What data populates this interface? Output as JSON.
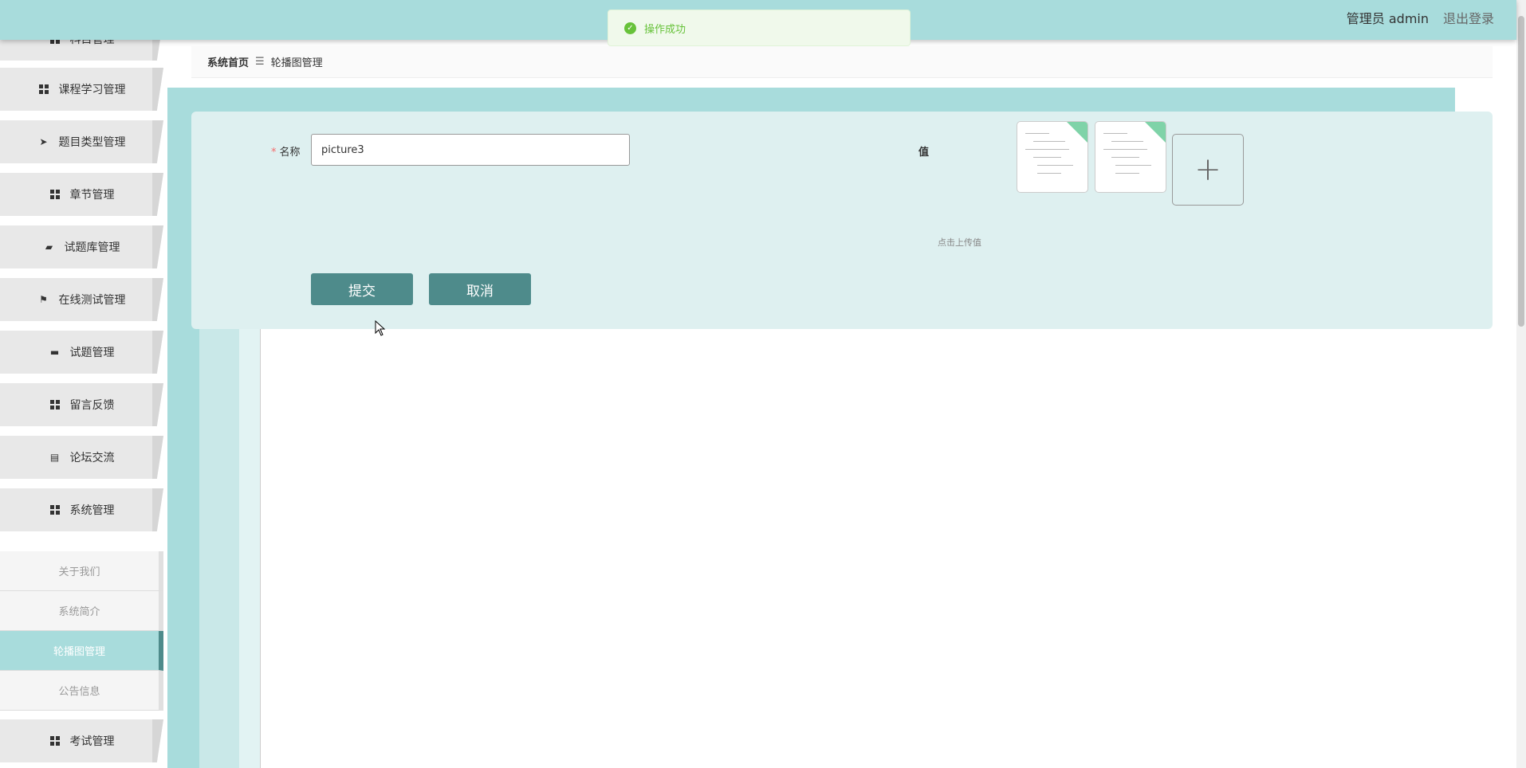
{
  "topbar": {
    "user": "管理员 admin",
    "logout": "退出登录"
  },
  "toast": {
    "message": "操作成功",
    "icon": "check-circle-icon",
    "color": "#67c23a"
  },
  "sidebar": {
    "items": [
      {
        "label": "科目管理",
        "icon": "grid-icon"
      },
      {
        "label": "课程学习管理",
        "icon": "grid-icon"
      },
      {
        "label": "题目类型管理",
        "icon": "paper-plane-icon"
      },
      {
        "label": "章节管理",
        "icon": "grid-icon"
      },
      {
        "label": "试题库管理",
        "icon": "ticket-icon"
      },
      {
        "label": "在线测试管理",
        "icon": "flag-icon"
      },
      {
        "label": "试题管理",
        "icon": "monitor-icon"
      },
      {
        "label": "留言反馈",
        "icon": "grid-icon"
      },
      {
        "label": "论坛交流",
        "icon": "clipboard-icon"
      },
      {
        "label": "系统管理",
        "icon": "grid-icon"
      }
    ],
    "submenu": [
      {
        "label": "关于我们"
      },
      {
        "label": "系统简介"
      },
      {
        "label": "轮播图管理",
        "active": true
      },
      {
        "label": "公告信息"
      }
    ],
    "last_item": {
      "label": "考试管理",
      "icon": "grid-icon"
    }
  },
  "breadcrumb": {
    "home": "系统首页",
    "separator": "☰",
    "current": "轮播图管理"
  },
  "form": {
    "name_label": "名称",
    "name_value": "picture3",
    "value_label": "值",
    "upload_hint": "点击上传值",
    "submit_label": "提交",
    "cancel_label": "取消"
  },
  "colors": {
    "accent": "#a8dcdc",
    "button": "#4e8b8b",
    "panel": "#def0f0"
  }
}
